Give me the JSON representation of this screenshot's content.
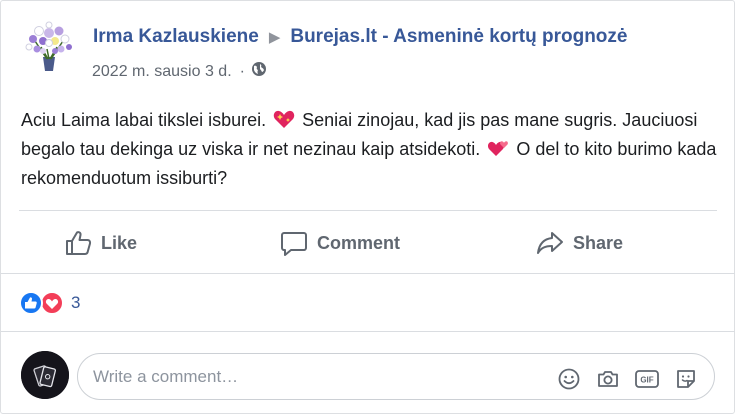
{
  "post": {
    "author": "Irma Kazlauskiene",
    "target_page": "Burejas.lt - Asmeninė kortų prognozė",
    "date": "2022 m. sausio 3 d.",
    "text_part1": "Aciu Laima labai tikslei isburei.",
    "text_part2": "Seniai zinojau, kad jis pas mane sugris. Jauciuosi begalo tau dekinga uz viska ir net nezinau kaip atsidekoti.",
    "text_part3": "O del to kito burimo kada rekomenduotum issiburti?"
  },
  "actions": {
    "like_label": "Like",
    "comment_label": "Comment",
    "share_label": "Share"
  },
  "reactions": {
    "count": "3",
    "types": [
      "like-icon",
      "love-icon"
    ]
  },
  "comment_box": {
    "placeholder": "Write a comment…",
    "tools": [
      "emoji-icon",
      "camera-icon",
      "gif-icon",
      "sticker-icon"
    ]
  },
  "colors": {
    "link": "#385898",
    "muted": "#606770",
    "like_blue": "#1877f2",
    "love_red": "#f33e58"
  }
}
